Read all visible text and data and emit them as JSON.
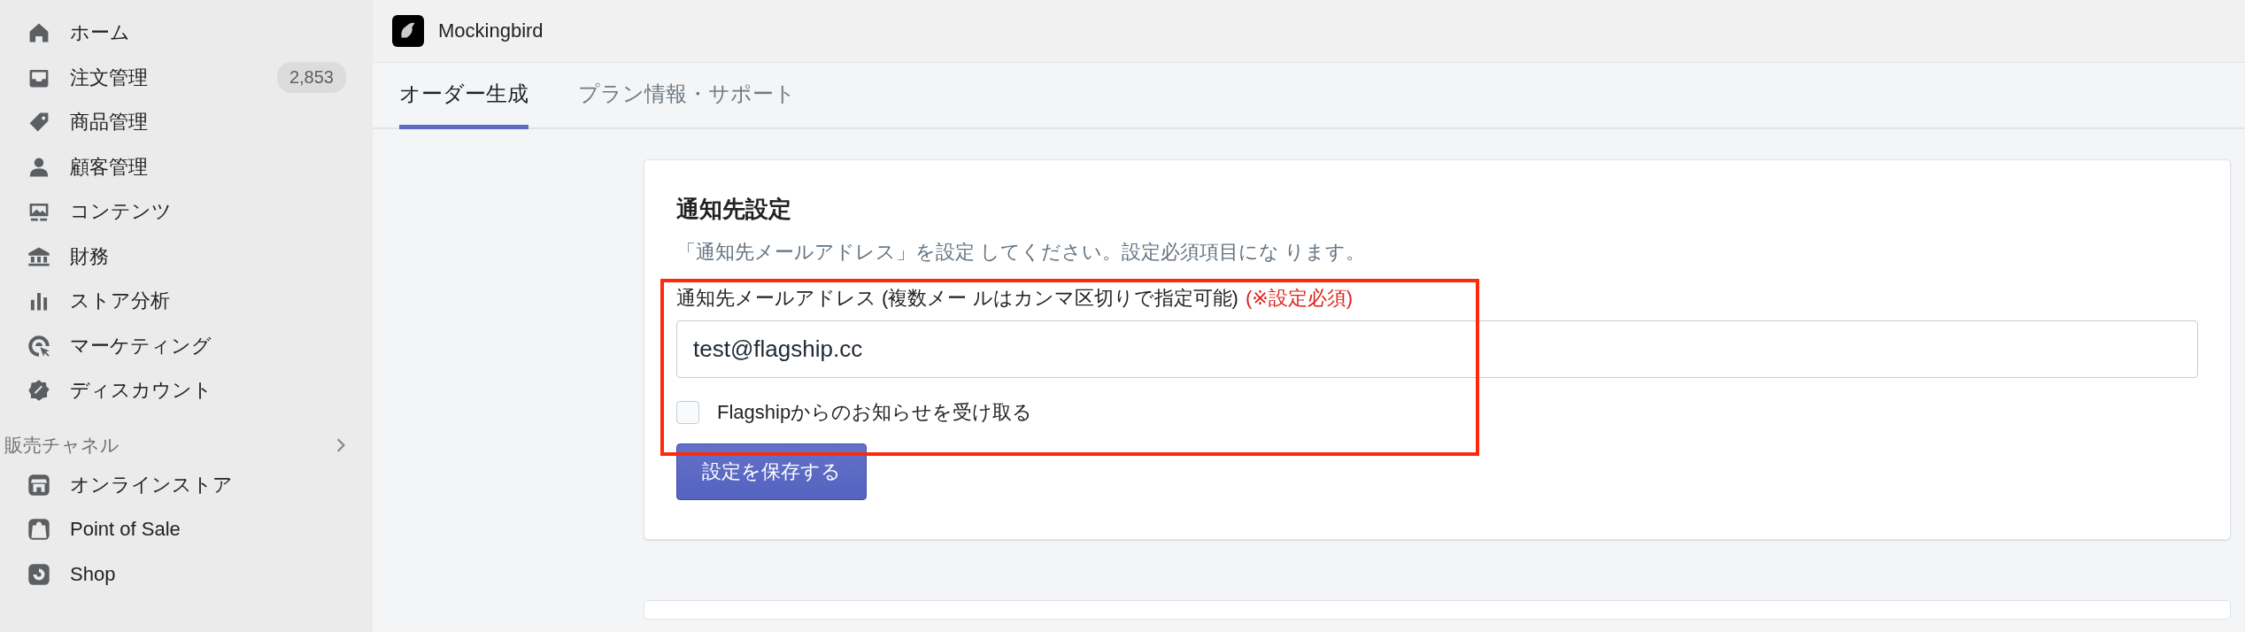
{
  "sidebar": {
    "items": [
      {
        "label": "ホーム",
        "selected": false
      },
      {
        "label": "注文管理",
        "selected": false,
        "badge": "2,853"
      },
      {
        "label": "商品管理",
        "selected": false
      },
      {
        "label": "顧客管理",
        "selected": false
      },
      {
        "label": "コンテンツ",
        "selected": false
      },
      {
        "label": "財務",
        "selected": false
      },
      {
        "label": "ストア分析",
        "selected": false
      },
      {
        "label": "マーケティング",
        "selected": false
      },
      {
        "label": "ディスカウント",
        "selected": false
      }
    ],
    "section": {
      "title": "販売チャネル",
      "items": [
        {
          "label": "オンラインストア"
        },
        {
          "label": "Point of Sale"
        },
        {
          "label": "Shop"
        }
      ]
    }
  },
  "app": {
    "name": "Mockingbird"
  },
  "tabs": [
    {
      "label": "オーダー生成",
      "selected": true
    },
    {
      "label": "プラン情報・サポート",
      "selected": false
    }
  ],
  "card": {
    "title": "通知先設定",
    "description": "「通知先メールアドレス」を設定 してください。設定必須項目にな ります。",
    "field": {
      "label": "通知先メールアドレス (複数メー ルはカンマ区切りで指定可能)",
      "required": "(※設定必須)",
      "value": "test@flagship.cc"
    },
    "checkbox": {
      "label": "Flagshipからのお知らせを受け取る",
      "checked": false
    },
    "button": "設定を保存する",
    "highlighted": true
  }
}
